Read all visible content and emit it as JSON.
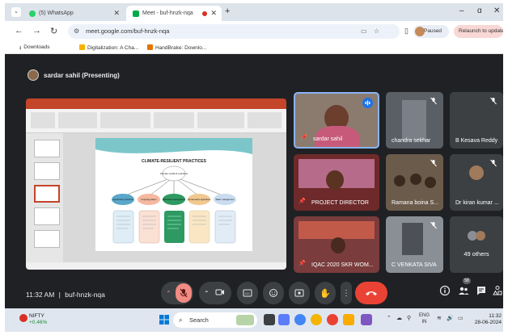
{
  "browser": {
    "tabs": [
      {
        "label": "(5) WhatsApp",
        "active": false
      },
      {
        "label": "Meet - buf-hnzk-nqa",
        "active": true
      }
    ],
    "new_tab": "+",
    "window_controls": [
      "–",
      "ɑ",
      "✕"
    ],
    "url": "meet.google.com/buf-hnzk-nqa",
    "profile_status": "Paused",
    "relaunch": "Relaunch to update",
    "bookmarks": [
      {
        "label": "Downloads",
        "icon": "download-icon"
      },
      {
        "label": "Digitalization: A Cha...",
        "icon": "bookmark-icon"
      },
      {
        "label": "HandBrake: Downlo...",
        "icon": "pineapple-icon"
      }
    ]
  },
  "meet": {
    "presenting": "sardar sahil (Presenting)",
    "slide": {
      "title": "CLIMATE-RESILIENT PRACTICES",
      "center": "Climate-resilient practices",
      "branches": [
        "Agroforestry practices",
        "Cropping pattern",
        "Watershed management",
        "Conservation agriculture",
        "Water management"
      ]
    },
    "participants": [
      {
        "name": "sardar sahil",
        "muted": false,
        "speaking": true
      },
      {
        "name": "chandra sekhar",
        "muted": true
      },
      {
        "name": "B Kesava Reddy",
        "muted": true
      },
      {
        "name": "PROJECT DIRECTOR",
        "muted": false
      },
      {
        "name": "Ramana boina S...",
        "muted": true
      },
      {
        "name": "Dr kiran kumar ...",
        "muted": true
      },
      {
        "name": "IQAC 2020 SKR WOM...",
        "muted": false
      },
      {
        "name": "C VENKATA SIVA",
        "muted": true
      }
    ],
    "others": "49 others",
    "time": "11:32 AM",
    "meeting_code": "buf-hnzk-nqa",
    "people_count": "58"
  },
  "taskbar": {
    "ticker_name": "NIFTY",
    "ticker_change": "+0.46%",
    "search": "Search",
    "lang_top": "ENG",
    "lang_bottom": "IN",
    "time": "11:32",
    "date": "28-06-2024"
  },
  "colors": {
    "meet_bg": "#202124",
    "tile_bg": "#3c4043",
    "end_call": "#ea4335",
    "mic_off": "#f28b82",
    "active_border": "#8ab4f8"
  }
}
